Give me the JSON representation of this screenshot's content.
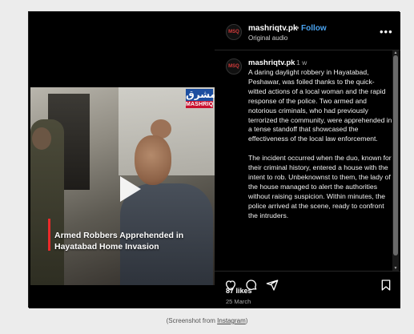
{
  "post": {
    "username": "mashriqtv.pk",
    "separator": "•",
    "follow_label": "Follow",
    "audio_label": "Original audio",
    "more_icon": "more-horizontal-icon",
    "avatar_text": "MSQ"
  },
  "video": {
    "caption_line1": "Armed Robbers Apprehended in",
    "caption_line2": "Hayatabad Home Invasion",
    "brand_top": "مشرق",
    "brand_bottom": "MASHRIQ",
    "play_icon": "play-icon",
    "accent": "#ea2a2a"
  },
  "comment": {
    "username": "mashriqtv.pk",
    "time": "1 w",
    "paragraph1": "A daring daylight robbery in Hayatabad, Peshawar, was foiled thanks to the quick-witted actions of a local woman and the rapid response of the police. Two armed and notorious criminals, who had previously terrorized the community, were apprehended in a tense standoff that showcased the effectiveness of the local law enforcement.",
    "paragraph2": "The incident occurred when the duo, known for their criminal history, entered a house with the intent to rob. Unbeknownst to them, the lady of the house managed to alert the authorities without raising suspicion. Within minutes, the police arrived at the scene, ready to confront the intruders."
  },
  "actions": {
    "like_icon": "heart-icon",
    "comment_icon": "comment-icon",
    "share_icon": "send-icon",
    "save_icon": "bookmark-icon"
  },
  "stats": {
    "likes": "87 likes",
    "date": "25 March"
  },
  "credit": {
    "prefix": "(Screenshot from ",
    "link": "Instagram",
    "suffix": ")"
  },
  "colors": {
    "follow": "#4aa3f0",
    "background": "#000000",
    "page": "#ececec"
  }
}
